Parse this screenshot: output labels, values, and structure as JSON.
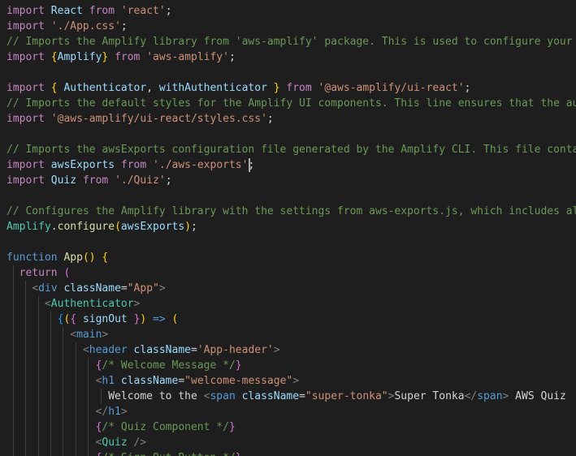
{
  "editor": {
    "colors": {
      "background": "#1e1e1e",
      "keyword": "#c586c0",
      "string": "#ce9178",
      "comment": "#6a9955",
      "function": "#dcdcaa",
      "variable": "#9cdcfe",
      "tag": "#569cd6",
      "component": "#4ec9b0",
      "bracket_1": "#ffd700",
      "bracket_2": "#da70d6",
      "bracket_3": "#179fff"
    },
    "lines": [
      [
        [
          "kw",
          "import"
        ],
        [
          "punc",
          " "
        ],
        [
          "var",
          "React"
        ],
        [
          "punc",
          " "
        ],
        [
          "kw",
          "from"
        ],
        [
          "punc",
          " "
        ],
        [
          "str",
          "'react'"
        ],
        [
          "punc",
          ";"
        ]
      ],
      [
        [
          "kw",
          "import"
        ],
        [
          "punc",
          " "
        ],
        [
          "str",
          "'./App.css'"
        ],
        [
          "punc",
          ";"
        ]
      ],
      [
        [
          "cmt",
          "// Imports the Amplify library from 'aws-amplify' package. This is used to configure your app to"
        ]
      ],
      [
        [
          "kw",
          "import"
        ],
        [
          "punc",
          " "
        ],
        [
          "br1",
          "{"
        ],
        [
          "var",
          "Amplify"
        ],
        [
          "br1",
          "}"
        ],
        [
          "punc",
          " "
        ],
        [
          "kw",
          "from"
        ],
        [
          "punc",
          " "
        ],
        [
          "str",
          "'aws-amplify'"
        ],
        [
          "punc",
          ";"
        ]
      ],
      [],
      [
        [
          "kw",
          "import"
        ],
        [
          "punc",
          " "
        ],
        [
          "br1",
          "{"
        ],
        [
          "punc",
          " "
        ],
        [
          "var",
          "Authenticator"
        ],
        [
          "punc",
          ", "
        ],
        [
          "var",
          "withAuthenticator"
        ],
        [
          "punc",
          " "
        ],
        [
          "br1",
          "}"
        ],
        [
          "punc",
          " "
        ],
        [
          "kw",
          "from"
        ],
        [
          "punc",
          " "
        ],
        [
          "str",
          "'@aws-amplify/ui-react'"
        ],
        [
          "punc",
          ";"
        ]
      ],
      [
        [
          "cmt",
          "// Imports the default styles for the Amplify UI components. This line ensures that the authenticator"
        ]
      ],
      [
        [
          "kw",
          "import"
        ],
        [
          "punc",
          " "
        ],
        [
          "str",
          "'@aws-amplify/ui-react/styles.css'"
        ],
        [
          "punc",
          ";"
        ]
      ],
      [],
      [
        [
          "cmt",
          "// Imports the awsExports configuration file generated by the Amplify CLI. This file contains"
        ]
      ],
      [
        [
          "kw",
          "import"
        ],
        [
          "punc",
          " "
        ],
        [
          "var",
          "awsExports"
        ],
        [
          "punc",
          " "
        ],
        [
          "kw",
          "from"
        ],
        [
          "punc",
          " "
        ],
        [
          "str",
          "'./aws-exports'"
        ],
        [
          "punc",
          ";"
        ]
      ],
      [
        [
          "kw",
          "import"
        ],
        [
          "punc",
          " "
        ],
        [
          "var",
          "Quiz"
        ],
        [
          "punc",
          " "
        ],
        [
          "kw",
          "from"
        ],
        [
          "punc",
          " "
        ],
        [
          "str",
          "'./Quiz'"
        ],
        [
          "punc",
          ";"
        ]
      ],
      [],
      [
        [
          "cmt",
          "// Configures the Amplify library with the settings from aws-exports.js, which includes all the AWS"
        ]
      ],
      [
        [
          "comp",
          "Amplify"
        ],
        [
          "punc",
          "."
        ],
        [
          "fn",
          "configure"
        ],
        [
          "br1",
          "("
        ],
        [
          "var",
          "awsExports"
        ],
        [
          "br1",
          ")"
        ],
        [
          "punc",
          ";"
        ]
      ],
      [],
      [
        [
          "dec",
          "function"
        ],
        [
          "punc",
          " "
        ],
        [
          "fn",
          "App"
        ],
        [
          "br1",
          "()"
        ],
        [
          "punc",
          " "
        ],
        [
          "br1",
          "{"
        ]
      ],
      [
        [
          "punc",
          "  "
        ],
        [
          "ctl",
          "return"
        ],
        [
          "punc",
          " "
        ],
        [
          "br2",
          "("
        ]
      ],
      [
        [
          "punc",
          "    "
        ],
        [
          "tagp",
          "<"
        ],
        [
          "tag",
          "div"
        ],
        [
          "punc",
          " "
        ],
        [
          "attr",
          "className"
        ],
        [
          "punc",
          "="
        ],
        [
          "str",
          "\"App\""
        ],
        [
          "tagp",
          ">"
        ]
      ],
      [
        [
          "punc",
          "      "
        ],
        [
          "tagp",
          "<"
        ],
        [
          "comp",
          "Authenticator"
        ],
        [
          "tagp",
          ">"
        ]
      ],
      [
        [
          "punc",
          "        "
        ],
        [
          "br3",
          "{"
        ],
        [
          "br1",
          "("
        ],
        [
          "br2",
          "{"
        ],
        [
          "punc",
          " "
        ],
        [
          "var",
          "signOut"
        ],
        [
          "punc",
          " "
        ],
        [
          "br2",
          "}"
        ],
        [
          "br1",
          ")"
        ],
        [
          "punc",
          " "
        ],
        [
          "dec",
          "=>"
        ],
        [
          "punc",
          " "
        ],
        [
          "br1",
          "("
        ]
      ],
      [
        [
          "punc",
          "          "
        ],
        [
          "tagp",
          "<"
        ],
        [
          "tag",
          "main"
        ],
        [
          "tagp",
          ">"
        ]
      ],
      [
        [
          "punc",
          "            "
        ],
        [
          "tagp",
          "<"
        ],
        [
          "tag",
          "header"
        ],
        [
          "punc",
          " "
        ],
        [
          "attr",
          "className"
        ],
        [
          "punc",
          "="
        ],
        [
          "str",
          "'App-header'"
        ],
        [
          "tagp",
          ">"
        ]
      ],
      [
        [
          "punc",
          "              "
        ],
        [
          "br2",
          "{"
        ],
        [
          "cmt",
          "/* Welcome Message */"
        ],
        [
          "br2",
          "}"
        ]
      ],
      [
        [
          "punc",
          "              "
        ],
        [
          "tagp",
          "<"
        ],
        [
          "tag",
          "h1"
        ],
        [
          "punc",
          " "
        ],
        [
          "attr",
          "className"
        ],
        [
          "punc",
          "="
        ],
        [
          "str",
          "\"welcome-message\""
        ],
        [
          "tagp",
          ">"
        ]
      ],
      [
        [
          "punc",
          "                Welcome to the "
        ],
        [
          "tagp",
          "<"
        ],
        [
          "tag",
          "span"
        ],
        [
          "punc",
          " "
        ],
        [
          "attr",
          "className"
        ],
        [
          "punc",
          "="
        ],
        [
          "str",
          "\"super-tonka\""
        ],
        [
          "tagp",
          ">"
        ],
        [
          "punc",
          "Super Tonka"
        ],
        [
          "tagp",
          "</"
        ],
        [
          "tag",
          "span"
        ],
        [
          "tagp",
          ">"
        ],
        [
          "punc",
          " AWS Quiz"
        ]
      ],
      [
        [
          "punc",
          "              "
        ],
        [
          "tagp",
          "</"
        ],
        [
          "tag",
          "h1"
        ],
        [
          "tagp",
          ">"
        ]
      ],
      [
        [
          "punc",
          "              "
        ],
        [
          "br2",
          "{"
        ],
        [
          "cmt",
          "/* Quiz Component */"
        ],
        [
          "br2",
          "}"
        ]
      ],
      [
        [
          "punc",
          "              "
        ],
        [
          "tagp",
          "<"
        ],
        [
          "comp",
          "Quiz"
        ],
        [
          "punc",
          " "
        ],
        [
          "tagp",
          "/>"
        ]
      ],
      [
        [
          "punc",
          "              "
        ],
        [
          "br2",
          "{"
        ],
        [
          "cmt",
          "/* Sign Out Button */"
        ],
        [
          "br2",
          "}"
        ]
      ]
    ]
  }
}
